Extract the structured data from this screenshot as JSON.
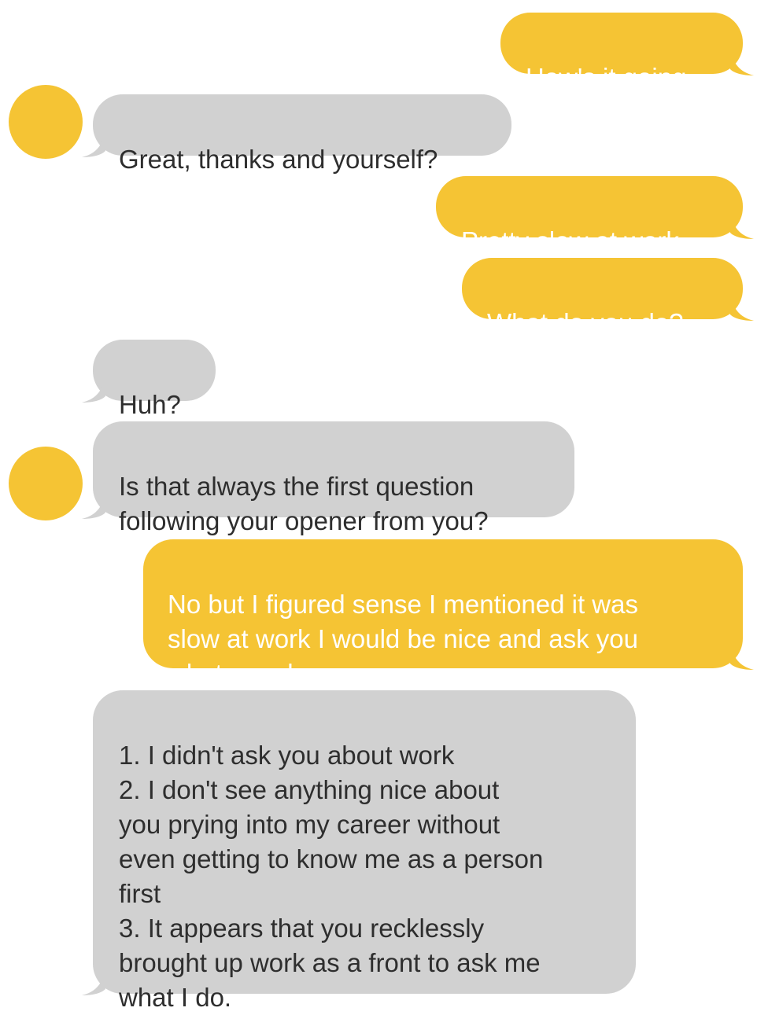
{
  "conversation": {
    "messages": [
      {
        "sender": "me",
        "text": "How's it going"
      },
      {
        "sender": "them",
        "text": "Great, thanks and yourself?"
      },
      {
        "sender": "me",
        "text": "Pretty slow at work"
      },
      {
        "sender": "me",
        "text": "What do you do?"
      },
      {
        "sender": "them",
        "text": "Huh?"
      },
      {
        "sender": "them",
        "text": "Is that always the first question\nfollowing your opener from you?"
      },
      {
        "sender": "me",
        "text": "No but I figured sense I mentioned it was\nslow at work I would be nice and ask you\nwhat you do"
      },
      {
        "sender": "them",
        "text": "1. I didn't ask you about work\n2. I don't see anything nice about\nyou prying into my career without\neven getting to know me as a person\nfirst\n3. It appears that you recklessly\nbrought up work as a front to ask me\nwhat I do."
      }
    ]
  },
  "colors": {
    "sent_bubble": "#f5c434",
    "received_bubble": "#d1d1d1",
    "avatar": "#f5c434",
    "sent_text": "#ffffff",
    "received_text": "#2e2e2e"
  }
}
